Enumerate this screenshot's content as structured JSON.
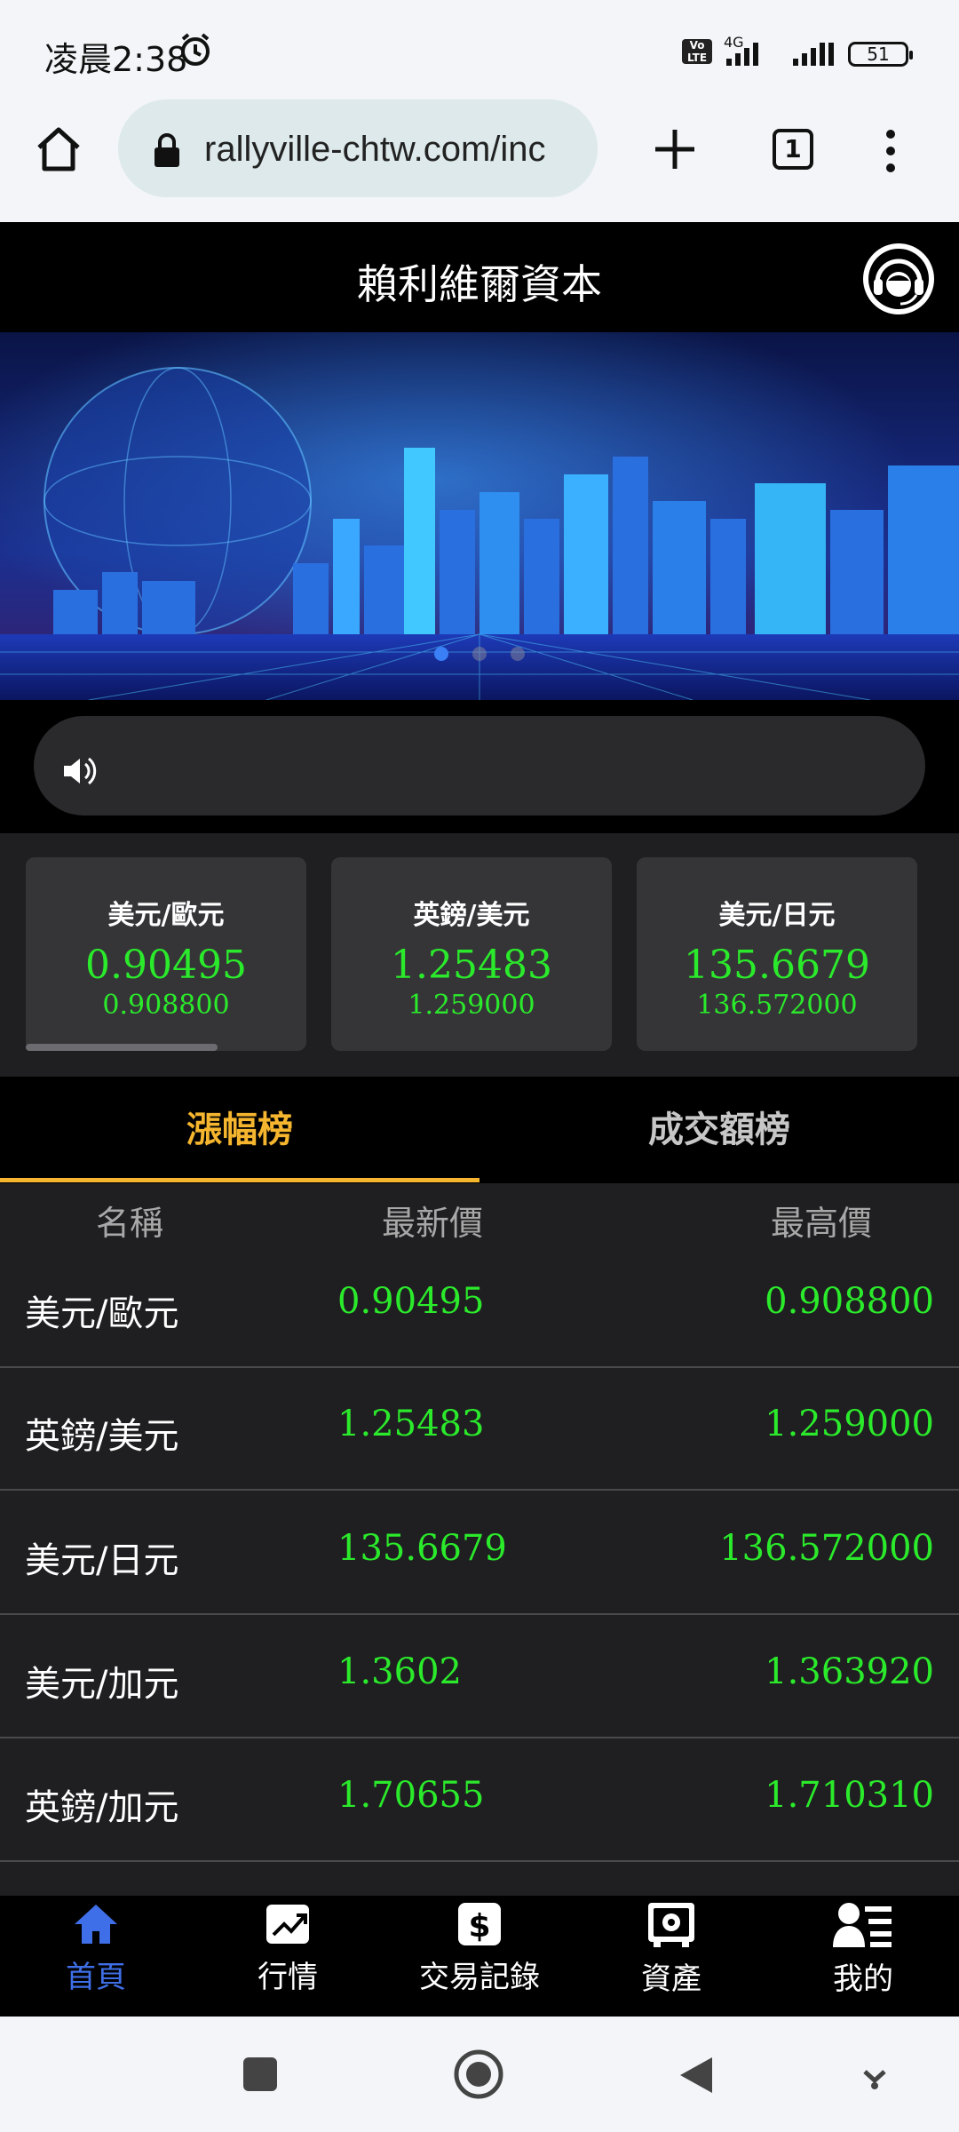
{
  "status_bar": {
    "time": "凌晨2:38",
    "network": "4G",
    "volte": "Vo LTE",
    "battery": "51"
  },
  "browser": {
    "url": "rallyville-chtw.com/inc",
    "tab_count": "1"
  },
  "header": {
    "title": "賴利維爾資本"
  },
  "tickers": [
    {
      "pair": "美元/歐元",
      "last": "0.90495",
      "high": "0.908800"
    },
    {
      "pair": "英鎊/美元",
      "last": "1.25483",
      "high": "1.259000"
    },
    {
      "pair": "美元/日元",
      "last": "135.6679",
      "high": "136.572000"
    }
  ],
  "tabs": {
    "gain": "漲幅榜",
    "volume": "成交額榜"
  },
  "table": {
    "headers": [
      "名稱",
      "最新價",
      "最高價"
    ],
    "rows": [
      {
        "name": "美元/歐元",
        "price": "0.90495",
        "high": "0.908800"
      },
      {
        "name": "英鎊/美元",
        "price": "1.25483",
        "high": "1.259000"
      },
      {
        "name": "美元/日元",
        "price": "135.6679",
        "high": "136.572000"
      },
      {
        "name": "美元/加元",
        "price": "1.3602",
        "high": "1.363920"
      },
      {
        "name": "英鎊/加元",
        "price": "1.70655",
        "high": "1.710310"
      }
    ]
  },
  "bottom_nav": [
    {
      "label": "首頁",
      "icon": "home-icon"
    },
    {
      "label": "行情",
      "icon": "chart-icon"
    },
    {
      "label": "交易記錄",
      "icon": "dollar-icon"
    },
    {
      "label": "資產",
      "icon": "safe-icon"
    },
    {
      "label": "我的",
      "icon": "user-list-icon"
    }
  ],
  "colors": {
    "up_green": "#2bea2b",
    "accent_gold": "#f5b52e",
    "nav_active": "#3f6fe8"
  }
}
